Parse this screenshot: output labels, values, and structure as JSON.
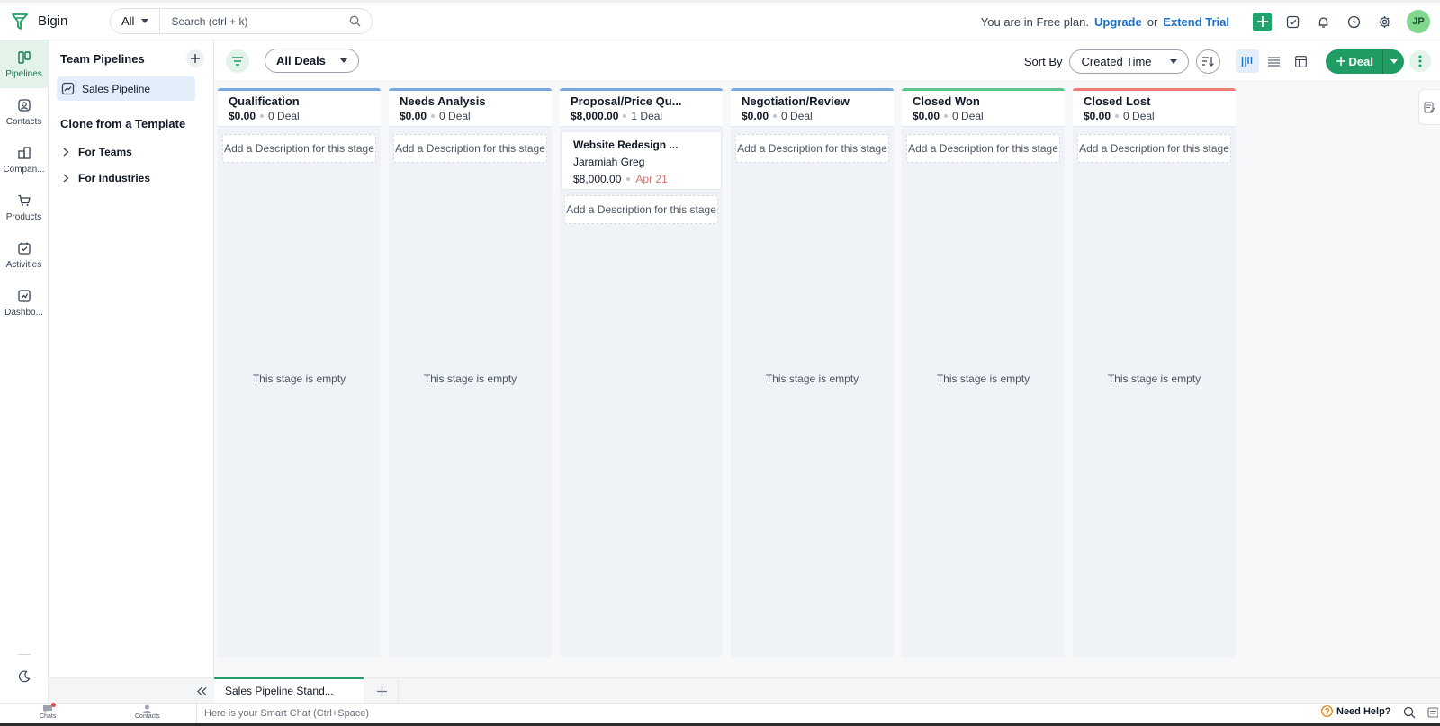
{
  "app": {
    "name": "Bigin"
  },
  "search": {
    "scope": "All",
    "placeholder": "Search (ctrl + k)"
  },
  "plan": {
    "text": "You are in Free plan.",
    "upgrade": "Upgrade",
    "or": "or",
    "extend": "Extend Trial"
  },
  "user": {
    "initials": "JP"
  },
  "rail": {
    "items": [
      {
        "label": "Pipelines",
        "icon": "pipeline-icon"
      },
      {
        "label": "Contacts",
        "icon": "contact-icon"
      },
      {
        "label": "Compan...",
        "icon": "company-icon"
      },
      {
        "label": "Products",
        "icon": "cart-icon"
      },
      {
        "label": "Activities",
        "icon": "calendar-check-icon"
      },
      {
        "label": "Dashbo...",
        "icon": "dashboard-icon"
      }
    ]
  },
  "sidebar": {
    "team_title": "Team Pipelines",
    "pipeline": "Sales Pipeline",
    "clone_title": "Clone from a Template",
    "tree": [
      "For Teams",
      "For Industries"
    ]
  },
  "toolbar": {
    "view_filter": "All Deals",
    "sort_label": "Sort By",
    "sort_value": "Created Time",
    "deal_button": "Deal"
  },
  "stages": [
    {
      "name": "Qualification",
      "amount": "$0.00",
      "count": "0 Deal",
      "color": "#7aa6de",
      "description": "Add a Description for this stage",
      "empty": "This stage is empty"
    },
    {
      "name": "Needs Analysis",
      "amount": "$0.00",
      "count": "0 Deal",
      "color": "#7aa6de",
      "description": "Add a Description for this stage",
      "empty": "This stage is empty"
    },
    {
      "name": "Proposal/Price Qu...",
      "amount": "$8,000.00",
      "count": "1 Deal",
      "color": "#7aa6de",
      "description": "Add a Description for this stage",
      "empty": ""
    },
    {
      "name": "Negotiation/Review",
      "amount": "$0.00",
      "count": "0 Deal",
      "color": "#7aa6de",
      "description": "Add a Description for this stage",
      "empty": "This stage is empty"
    },
    {
      "name": "Closed Won",
      "amount": "$0.00",
      "count": "0 Deal",
      "color": "#5cc58a",
      "description": "Add a Description for this stage",
      "empty": "This stage is empty"
    },
    {
      "name": "Closed Lost",
      "amount": "$0.00",
      "count": "0 Deal",
      "color": "#ec7b74",
      "description": "Add a Description for this stage",
      "empty": "This stage is empty"
    }
  ],
  "deal_card": {
    "title": "Website Redesign ...",
    "contact": "Jaramiah Greg",
    "amount": "$8,000.00",
    "date": "Apr 21"
  },
  "bottom": {
    "view_tab": "Sales Pipeline Stand..."
  },
  "status": {
    "chats": "Chats",
    "contacts": "Contacts",
    "smart_chat": "Here is your Smart Chat (Ctrl+Space)",
    "help": "Need Help?"
  }
}
